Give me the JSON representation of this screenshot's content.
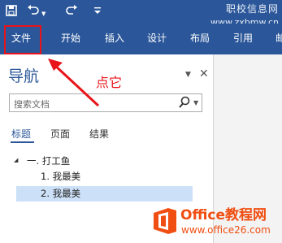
{
  "watermark_top": {
    "line1": "职校信息网",
    "line2": "www.zxbmw.cn"
  },
  "qat": {
    "save_icon": "save-icon",
    "undo_icon": "undo-icon",
    "redo_icon": "redo-icon",
    "customize_icon": "chevron-down-icon"
  },
  "ribbon": {
    "tabs": [
      "文件",
      "开始",
      "插入",
      "设计",
      "布局",
      "引用",
      "邮"
    ],
    "highlighted_tab": "文件"
  },
  "annotation": {
    "text": "点它",
    "color": "#e8141a"
  },
  "nav_pane": {
    "title": "导航",
    "search_placeholder": "搜索文档",
    "tabs": [
      "标题",
      "页面",
      "结果"
    ],
    "active_tab": "标题",
    "headings": [
      "一. 打工鱼",
      "1. 我最美",
      "2. 我最美"
    ],
    "selected_heading": "2. 我最美"
  },
  "brand": {
    "name": "Office教程网",
    "url": "www.office26.com"
  },
  "colors": {
    "ribbon": "#2b579a",
    "accent": "#2b579a",
    "highlight": "#e8141a",
    "brand": "#f04e12",
    "selection": "#cce0f7"
  }
}
